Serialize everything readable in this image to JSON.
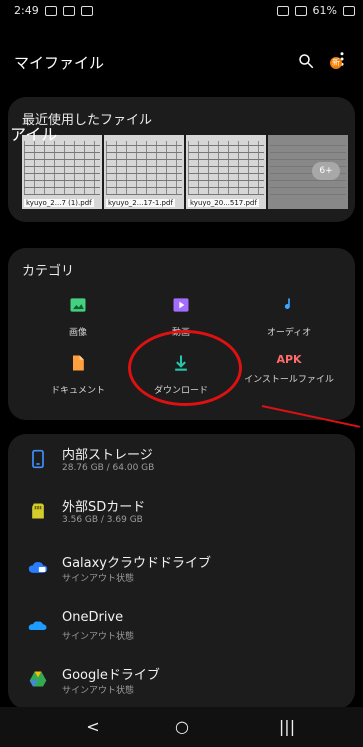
{
  "status": {
    "time": "2:49",
    "battery": "61%"
  },
  "appbar": {
    "title": "マイファイル",
    "badge": "新"
  },
  "recent": {
    "title": "最近使用したファイル",
    "overlay": "アイル",
    "items": [
      {
        "label": "kyuyo_2...7 (1).pdf"
      },
      {
        "label": "kyuyo_2...17-1.pdf"
      },
      {
        "label": "kyuyo_20...517.pdf"
      },
      {
        "label": "6+"
      }
    ]
  },
  "category": {
    "title": "カテゴリ",
    "items": [
      {
        "label": "画像",
        "icon": "image-icon",
        "color": "#45d17f"
      },
      {
        "label": "動画",
        "icon": "video-icon",
        "color": "#a46cff"
      },
      {
        "label": "オーディオ",
        "icon": "audio-icon",
        "color": "#3aa6ff"
      },
      {
        "label": "ドキュメント",
        "icon": "document-icon",
        "color": "#ff9f3e"
      },
      {
        "label": "ダウンロード",
        "icon": "download-icon",
        "color": "#24c7ad"
      },
      {
        "label": "インストールファイル",
        "icon": "apk-icon",
        "color": "#ff6b6b",
        "text": "APK"
      }
    ]
  },
  "storage": {
    "items": [
      {
        "name": "内部ストレージ",
        "sub": "28.76 GB / 64.00 GB",
        "icon": "phone-icon",
        "color": "#3e92ff"
      },
      {
        "name": "外部SDカード",
        "sub": "3.56 GB / 3.69 GB",
        "icon": "sd-card-icon",
        "color": "#d4cc2d"
      },
      {
        "name": "Galaxyクラウドドライブ",
        "sub": "サインアウト状態",
        "icon": "cloud-icon",
        "color": "#2a7dff"
      },
      {
        "name": "OneDrive",
        "sub": "サインアウト状態",
        "icon": "onedrive-icon",
        "color": "#1f9cff"
      },
      {
        "name": "Googleドライブ",
        "sub": "サインアウト状態",
        "icon": "google-drive-icon",
        "color": "#34a853"
      }
    ]
  },
  "nav": {
    "back": "<",
    "home": "○",
    "recent": "|||"
  }
}
